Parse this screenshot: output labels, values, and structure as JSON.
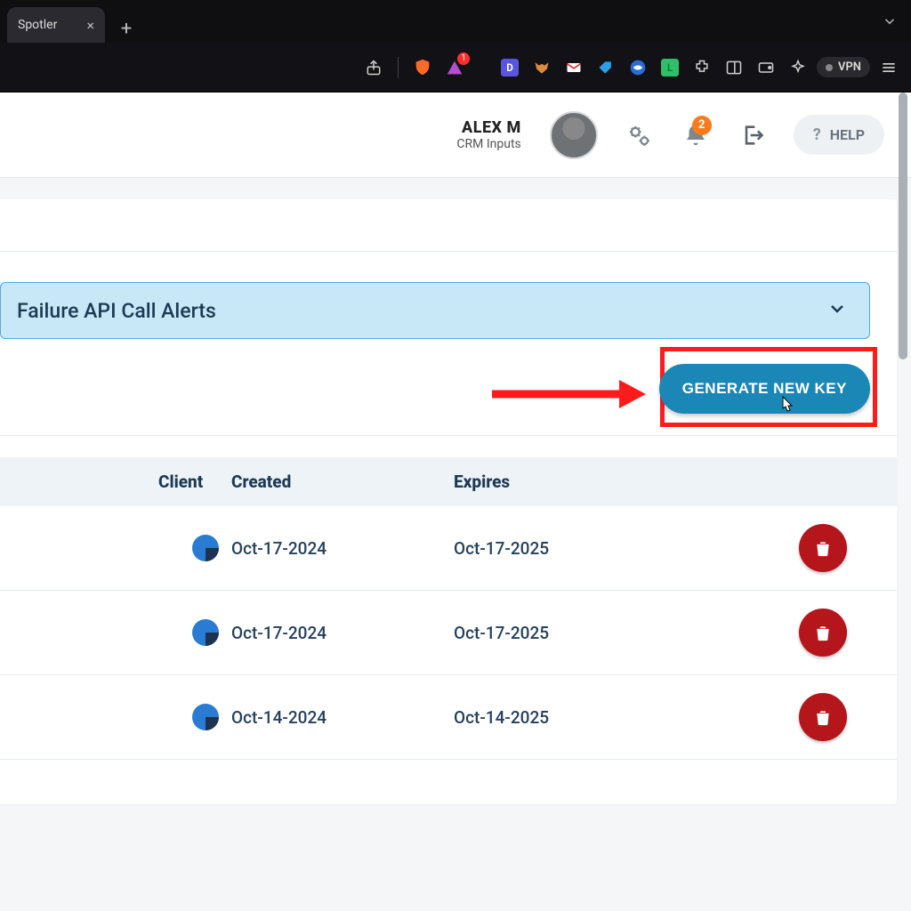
{
  "browser": {
    "tab_title": "Spotler",
    "ext_badge": "1",
    "vpn_label": "VPN"
  },
  "header": {
    "user_name": "ALEX M",
    "user_sub": "CRM Inputs",
    "notif_count": "2",
    "help_label": "HELP"
  },
  "panel": {
    "collapse_title": "Failure API Call Alerts",
    "generate_label": "GENERATE NEW KEY"
  },
  "table": {
    "headers": {
      "client": "Client",
      "created": "Created",
      "expires": "Expires"
    },
    "rows": [
      {
        "created": "Oct-17-2024",
        "expires": "Oct-17-2025"
      },
      {
        "created": "Oct-17-2024",
        "expires": "Oct-17-2025"
      },
      {
        "created": "Oct-14-2024",
        "expires": "Oct-14-2025"
      }
    ]
  },
  "colors": {
    "accent": "#1b87b6",
    "danger": "#b4161b",
    "highlight_border": "#ff1b1b"
  }
}
